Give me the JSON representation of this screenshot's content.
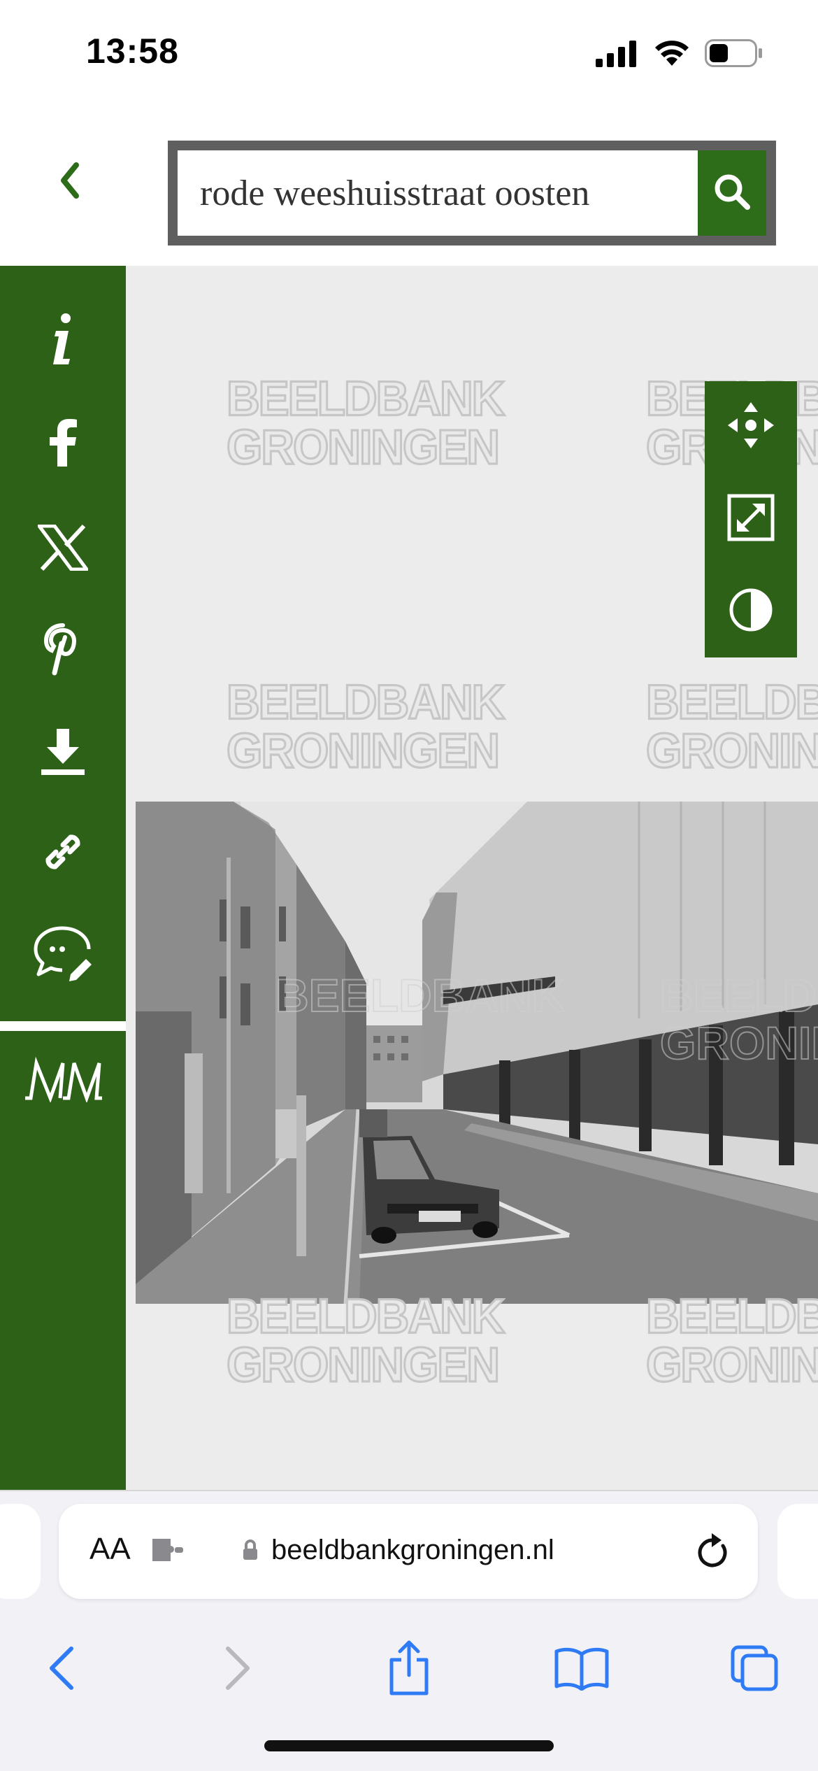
{
  "status_bar": {
    "time": "13:58",
    "icons": [
      "signal-icon",
      "wifi-icon",
      "battery-icon"
    ]
  },
  "header": {
    "back_icon": "chevron-left-icon",
    "search": {
      "value": "rode weeshuisstraat oosten",
      "placeholder": ""
    },
    "search_icon": "search-icon"
  },
  "sidebar": {
    "items": [
      {
        "name": "info",
        "icon": "info-icon"
      },
      {
        "name": "facebook",
        "icon": "facebook-icon"
      },
      {
        "name": "x",
        "icon": "x-logo-icon"
      },
      {
        "name": "pinterest",
        "icon": "pinterest-icon"
      },
      {
        "name": "download",
        "icon": "download-icon"
      },
      {
        "name": "link",
        "icon": "link-icon"
      },
      {
        "name": "comment",
        "icon": "comment-edit-icon"
      },
      {
        "name": "mm",
        "icon": "mm-logo-icon",
        "text": "MM"
      }
    ]
  },
  "viewer": {
    "watermark_line1": "BEELDBANK",
    "watermark_line2": "GRONINGEN",
    "tools": [
      {
        "name": "pan",
        "icon": "move-arrows-icon"
      },
      {
        "name": "fullscreen",
        "icon": "expand-icon"
      },
      {
        "name": "contrast",
        "icon": "contrast-icon"
      }
    ],
    "photo": "black-and-white street photo with parked car"
  },
  "browser": {
    "text_size_label": "AA",
    "url": "beeldbankgroningen.nl",
    "accent_color": "#2f7bf6",
    "icons": [
      "extension-icon",
      "lock-icon",
      "reload-icon",
      "back-arrow-icon",
      "forward-arrow-icon",
      "share-icon",
      "bookmarks-icon",
      "tabs-icon"
    ]
  },
  "colors": {
    "brand_green": "#2d6118",
    "search_green": "#2d6d1a",
    "viewer_bg": "#ececec",
    "search_border": "#5f5f5f"
  }
}
